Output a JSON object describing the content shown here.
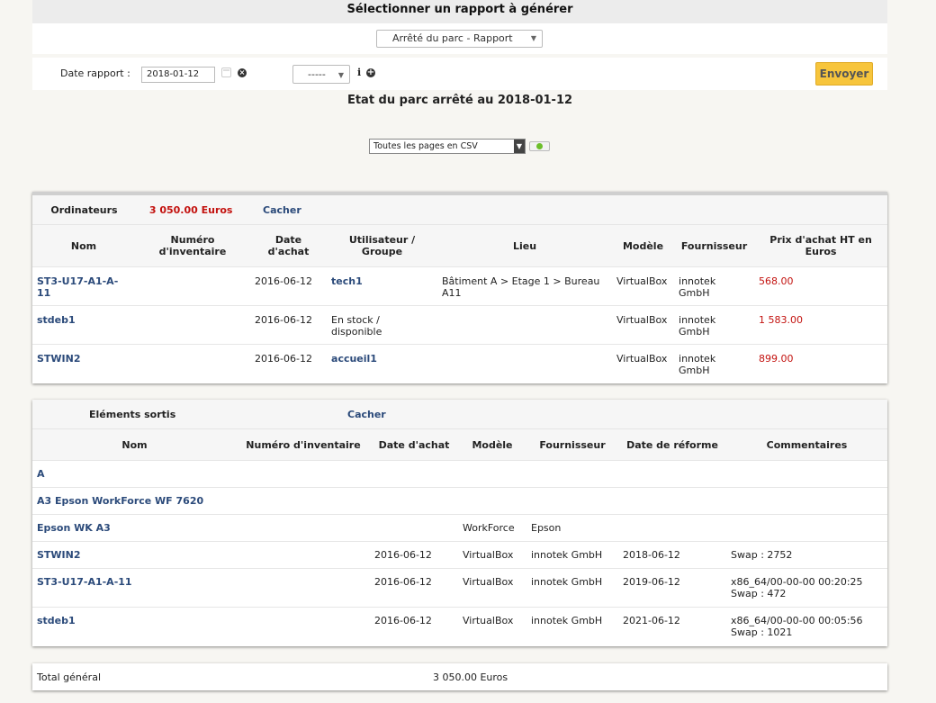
{
  "header": {
    "title": "Sélectionner un rapport à générer",
    "report_select": "Arrêté du parc - Rapport"
  },
  "form": {
    "date_label": "Date rapport :",
    "date_value": "2018-01-12",
    "filter_select": "-----",
    "info_glyph": "i",
    "clear_glyph": "×",
    "add_glyph": "+",
    "submit_label": "Envoyer"
  },
  "report": {
    "title": "Etat du parc arrêté au 2018-01-12",
    "export_select": "Toutes les pages en CSV"
  },
  "computers": {
    "section_label": "Ordinateurs",
    "total": "3 050.00 Euros",
    "hide_label": "Cacher",
    "columns": [
      "Nom",
      "Numéro d'inventaire",
      "Date d'achat",
      "Utilisateur / Groupe",
      "Lieu",
      "Modèle",
      "Fournisseur",
      "Prix d'achat HT en Euros"
    ],
    "rows": [
      {
        "name": "ST3-U17-A1-A-11",
        "inventory": "",
        "date": "2016-06-12",
        "user": "tech1",
        "user_link": true,
        "location": "Bâtiment A > Etage 1 > Bureau A11",
        "model": "VirtualBox",
        "supplier": "innotek GmbH",
        "price": "568.00"
      },
      {
        "name": "stdeb1",
        "inventory": "",
        "date": "2016-06-12",
        "user": "En stock / disponible",
        "user_link": false,
        "location": "",
        "model": "VirtualBox",
        "supplier": "innotek GmbH",
        "price": "1 583.00"
      },
      {
        "name": "STWIN2",
        "inventory": "",
        "date": "2016-06-12",
        "user": "accueil1",
        "user_link": true,
        "location": "",
        "model": "VirtualBox",
        "supplier": "innotek GmbH",
        "price": "899.00"
      }
    ]
  },
  "retired": {
    "section_label": "Eléments sortis",
    "hide_label": "Cacher",
    "columns": [
      "Nom",
      "Numéro d'inventaire",
      "Date d'achat",
      "Modèle",
      "Fournisseur",
      "Date de réforme",
      "Commentaires"
    ],
    "rows": [
      {
        "name": "A",
        "inventory": "",
        "date": "",
        "model": "",
        "supplier": "",
        "retire_date": "",
        "comment": ""
      },
      {
        "name": "A3 Epson WorkForce WF 7620",
        "inventory": "",
        "date": "",
        "model": "",
        "supplier": "",
        "retire_date": "",
        "comment": ""
      },
      {
        "name": "Epson WK A3",
        "inventory": "",
        "date": "",
        "model": "WorkForce",
        "supplier": "Epson",
        "retire_date": "",
        "comment": ""
      },
      {
        "name": "STWIN2",
        "inventory": "",
        "date": "2016-06-12",
        "model": "VirtualBox",
        "supplier": "innotek GmbH",
        "retire_date": "2018-06-12",
        "comment": "Swap : 2752"
      },
      {
        "name": "ST3-U17-A1-A-11",
        "inventory": "",
        "date": "2016-06-12",
        "model": "VirtualBox",
        "supplier": "innotek GmbH",
        "retire_date": "2019-06-12",
        "comment": "x86_64/00-00-00 00:20:25\nSwap : 472"
      },
      {
        "name": "stdeb1",
        "inventory": "",
        "date": "2016-06-12",
        "model": "VirtualBox",
        "supplier": "innotek GmbH",
        "retire_date": "2021-06-12",
        "comment": "x86_64/00-00-00 00:05:56\nSwap : 1021"
      }
    ]
  },
  "grand_total": {
    "label": "Total général",
    "value": "3 050.00 Euros"
  },
  "colors": {
    "accent_link": "#2b4a7a",
    "price_red": "#c3120f",
    "button_yellow": "#f7c53c"
  }
}
